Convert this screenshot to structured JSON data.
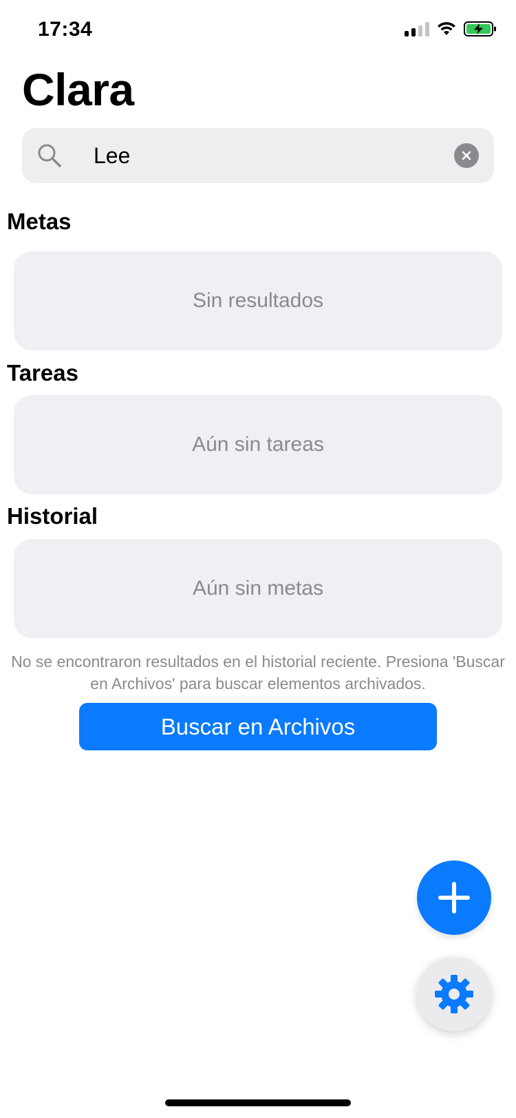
{
  "status_bar": {
    "time": "17:34",
    "icons": [
      "cellular-signal-icon",
      "wifi-icon",
      "battery-charging-icon"
    ]
  },
  "app": {
    "title": "Clara"
  },
  "search": {
    "value": "Lee",
    "placeholder": "",
    "icon": "search-icon",
    "clear_icon": "clear-icon"
  },
  "sections": {
    "goals": {
      "title": "Metas",
      "empty_text": "Sin resultados"
    },
    "tasks": {
      "title": "Tareas",
      "empty_text": "Aún sin tareas"
    },
    "history": {
      "title": "Historial",
      "empty_text": "Aún sin metas"
    }
  },
  "archive": {
    "info_text": "No se encontraron resultados en el historial reciente. Presiona 'Buscar en Archivos' para buscar elementos archivados.",
    "button_label": "Buscar en Archivos"
  },
  "fabs": {
    "add_icon": "plus-icon",
    "settings_icon": "gear-icon"
  },
  "colors": {
    "accent": "#0a7aff",
    "card_background": "#f0f0f4",
    "secondary_text": "#8a8a8e",
    "battery_green": "#34c759"
  }
}
